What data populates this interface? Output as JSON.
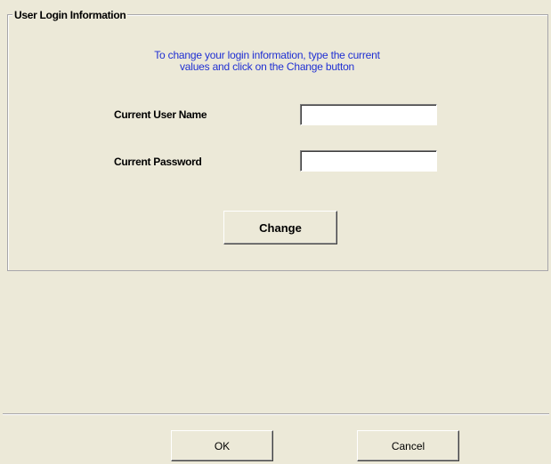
{
  "group": {
    "title": "User Login Information"
  },
  "instructions": {
    "line1": "To change your login information, type the current",
    "line2": "values and click on the Change button"
  },
  "fields": {
    "username_label": "Current User Name",
    "username_value": "",
    "password_label": "Current Password",
    "password_value": ""
  },
  "buttons": {
    "change": "Change",
    "ok": "OK",
    "cancel": "Cancel"
  },
  "colors": {
    "background": "#ece9d8",
    "instruction_text": "#1f2fd3",
    "groupbox_border": "#a7a6aa"
  }
}
